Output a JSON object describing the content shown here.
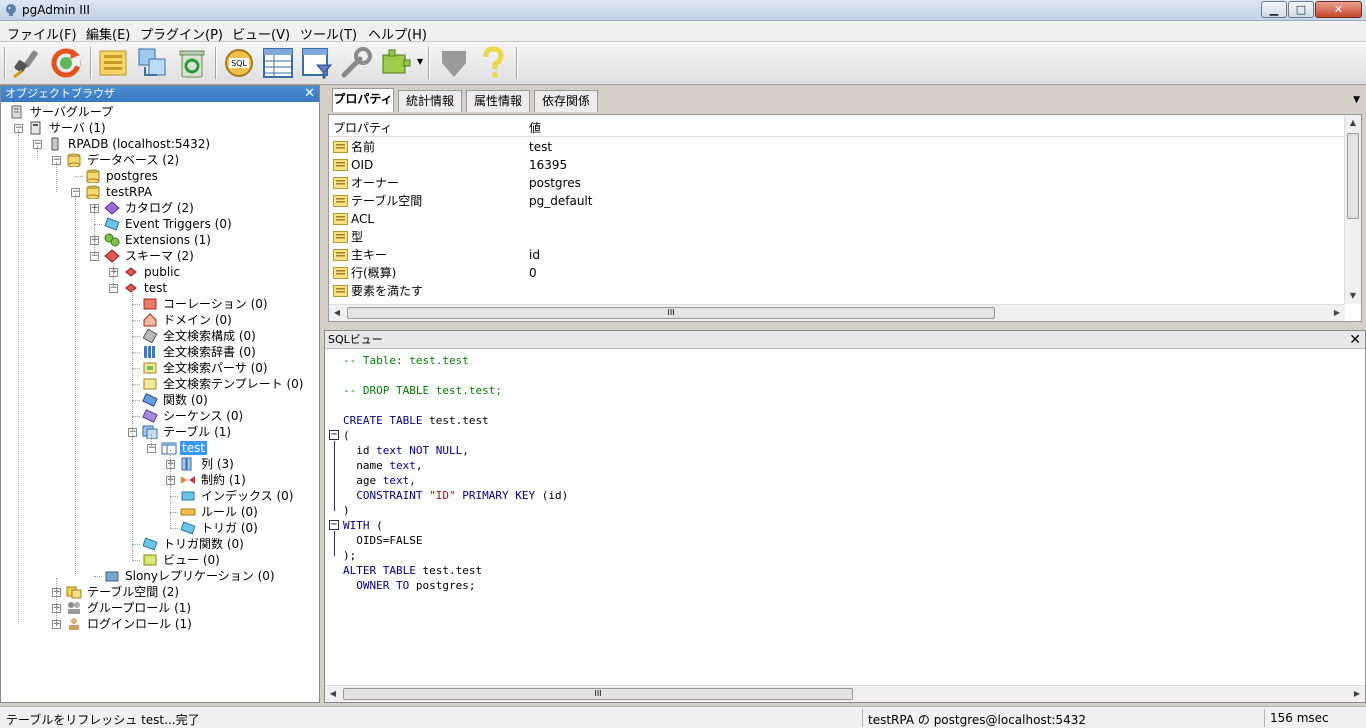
{
  "window": {
    "title": "pgAdmin III",
    "minimize": "▁",
    "maximize": "□",
    "close": "✕"
  },
  "menu": [
    "ファイル(F)",
    "編集(E)",
    "プラグイン(P)",
    "ビュー(V)",
    "ツール(T)",
    "ヘルプ(H)"
  ],
  "toolbar": {
    "icons": [
      "plug-icon",
      "refresh-icon",
      "properties-icon",
      "create-icon",
      "delete-icon",
      "sql-icon",
      "view-data-icon",
      "filter-data-icon",
      "maintenance-icon",
      "plugins-icon",
      "guru-icon",
      "help-icon"
    ],
    "sql_label": "SQL"
  },
  "object_browser": {
    "title": "オブジェクトブラウザ",
    "close": "✕",
    "nodes": [
      {
        "label": "サーバグループ"
      },
      {
        "label": "サーバ (1)"
      },
      {
        "label": "RPADB (localhost:5432)"
      },
      {
        "label": "データベース (2)"
      },
      {
        "label": "postgres"
      },
      {
        "label": "testRPA"
      },
      {
        "label": "カタログ (2)"
      },
      {
        "label": "Event Triggers (0)"
      },
      {
        "label": "Extensions (1)"
      },
      {
        "label": "スキーマ (2)"
      },
      {
        "label": "public"
      },
      {
        "label": "test"
      },
      {
        "label": "コーレーション (0)"
      },
      {
        "label": "ドメイン (0)"
      },
      {
        "label": "全文検索構成 (0)"
      },
      {
        "label": "全文検索辞書 (0)"
      },
      {
        "label": "全文検索パーサ (0)"
      },
      {
        "label": "全文検索テンプレート (0)"
      },
      {
        "label": "関数 (0)"
      },
      {
        "label": "シーケンス (0)"
      },
      {
        "label": "テーブル (1)"
      },
      {
        "label": "test"
      },
      {
        "label": "列 (3)"
      },
      {
        "label": "制約 (1)"
      },
      {
        "label": "インデックス (0)"
      },
      {
        "label": "ルール (0)"
      },
      {
        "label": "トリガ (0)"
      },
      {
        "label": "トリガ関数 (0)"
      },
      {
        "label": "ビュー (0)"
      },
      {
        "label": "Slonyレプリケーション (0)"
      },
      {
        "label": "テーブル空間 (2)"
      },
      {
        "label": "グループロール (1)"
      },
      {
        "label": "ログインロール (1)"
      }
    ]
  },
  "properties": {
    "tabs": [
      "プロパティ",
      "統計情報",
      "属性情報",
      "依存関係"
    ],
    "tabs_menu": "▼",
    "col_property": "プロパティ",
    "col_value": "値",
    "rows": [
      {
        "key": "名前",
        "value": "test"
      },
      {
        "key": "OID",
        "value": "16395"
      },
      {
        "key": "オーナー",
        "value": "postgres"
      },
      {
        "key": "テーブル空間",
        "value": "pg_default"
      },
      {
        "key": "ACL",
        "value": ""
      },
      {
        "key": "型",
        "value": ""
      },
      {
        "key": "主キー",
        "value": "id"
      },
      {
        "key": "行(概算)",
        "value": "0"
      },
      {
        "key": "要素を満たす",
        "value": ""
      }
    ],
    "scroll_grip": "III"
  },
  "sql_view": {
    "title": "SQLビュー",
    "close": "✕",
    "lines": [
      "-- Table: test.test",
      "",
      "-- DROP TABLE test.test;",
      "",
      "CREATE TABLE test.test",
      "(",
      "  id text NOT NULL,",
      "  name text,",
      "  age text,",
      "  CONSTRAINT \"ID\" PRIMARY KEY (id)",
      ")",
      "WITH (",
      "  OIDS=FALSE",
      ");",
      "ALTER TABLE test.test",
      "  OWNER TO postgres;"
    ],
    "scroll_grip": "III"
  },
  "status": {
    "message": "テーブルをリフレッシュ test...完了",
    "connection": "testRPA の postgres@localhost:5432",
    "timing": "156 msec"
  }
}
